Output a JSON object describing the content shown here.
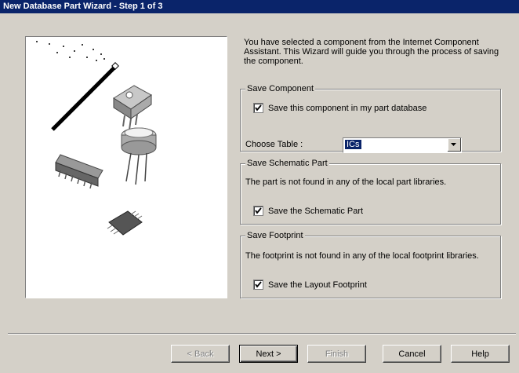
{
  "window": {
    "title": "New Database Part Wizard - Step 1 of 3"
  },
  "intro": {
    "text": "You have selected a component from the Internet Component Assistant.  This Wizard will guide you through the process of saving the component."
  },
  "save_component": {
    "legend": "Save Component",
    "checkbox_label": "Save this component in my part database",
    "checked": true,
    "choose_table_label": "Choose Table :",
    "choose_table_value": "ICs"
  },
  "save_schematic": {
    "legend": "Save Schematic Part",
    "message": "The part is not found in any of the local part libraries.",
    "checkbox_label": "Save the Schematic Part",
    "checked": true
  },
  "save_footprint": {
    "legend": "Save Footprint",
    "message": "The footprint is not found in any of the local footprint libraries.",
    "checkbox_label": "Save the Layout Footprint",
    "checked": true
  },
  "buttons": {
    "back": "< Back",
    "next": "Next >",
    "finish": "Finish",
    "cancel": "Cancel",
    "help": "Help"
  }
}
